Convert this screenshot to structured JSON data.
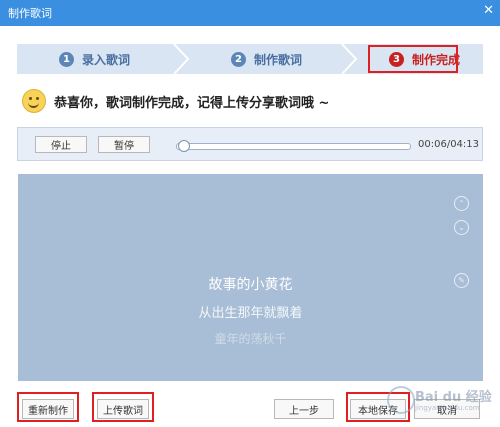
{
  "window": {
    "title": "制作歌词",
    "close_glyph": "✕"
  },
  "steps": [
    {
      "num": "1",
      "label": "录入歌词",
      "active": false
    },
    {
      "num": "2",
      "label": "制作歌词",
      "active": false
    },
    {
      "num": "3",
      "label": "制作完成",
      "active": true
    }
  ],
  "message": "恭喜你，歌词制作完成，记得上传分享歌词哦 ~",
  "player": {
    "stop_label": "停止",
    "pause_label": "暂停",
    "time": "00:06/04:13",
    "progress": 0.024
  },
  "lyrics": [
    "故事的小黄花",
    "从出生那年就飘着",
    "童年的荡秋千"
  ],
  "lyric_controls": {
    "up_glyph": "⌃",
    "down_glyph": "⌄",
    "edit_glyph": "✎"
  },
  "buttons": {
    "remake": "重新制作",
    "upload": "上传歌词",
    "prev": "上一步",
    "save_local": "本地保存",
    "cancel": "取消"
  },
  "watermark": {
    "text": "Bai du 经验",
    "sub": "jingyan.baidu.com"
  },
  "colors": {
    "titlebar": "#3a8fe0",
    "lyric_panel": "#a8bed6",
    "highlight": "#e02020",
    "current_lyric": "#ffffff"
  }
}
